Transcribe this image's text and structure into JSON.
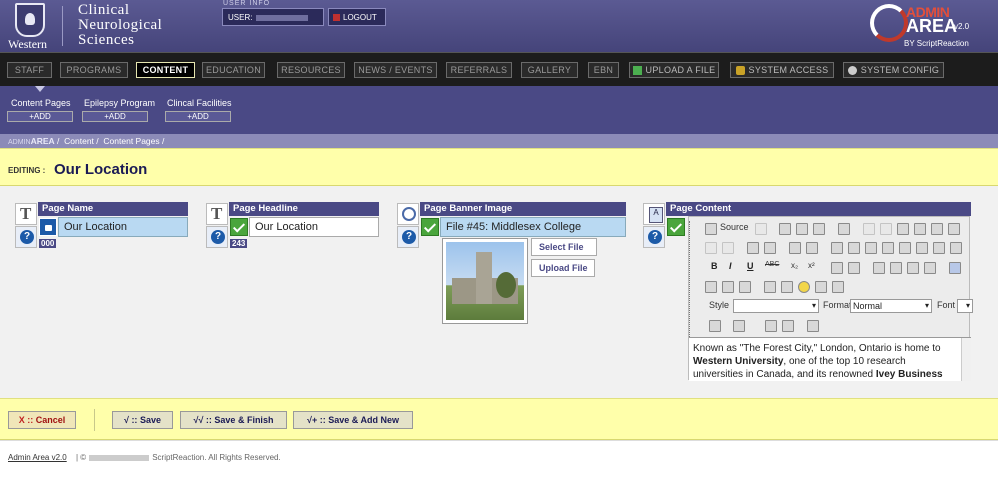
{
  "header": {
    "school": "Western",
    "department": "Clinical Neurological Sciences",
    "user_info_label": "USER INFO",
    "user_label": "USER:",
    "logout": "LOGOUT",
    "brand_top": "ADMIN",
    "brand_bottom": "AREA",
    "brand_version": "v2.0",
    "brand_by": "BY ScriptReaction"
  },
  "nav": [
    {
      "label": "STAFF"
    },
    {
      "label": "PROGRAMS"
    },
    {
      "label": "CONTENT",
      "active": true
    },
    {
      "label": "EDUCATION"
    },
    {
      "label": "RESOURCES"
    },
    {
      "label": "NEWS / EVENTS"
    },
    {
      "label": "REFERRALS"
    },
    {
      "label": "GALLERY"
    },
    {
      "label": "EBN"
    },
    {
      "label": "UPLOAD A FILE"
    },
    {
      "label": "SYSTEM ACCESS"
    },
    {
      "label": "SYSTEM CONFIG"
    }
  ],
  "subnav": [
    {
      "label": "Content Pages",
      "add": "+ADD"
    },
    {
      "label": "Epilepsy Program",
      "add": "+ADD"
    },
    {
      "label": "Clincal Facilities",
      "add": "+ADD"
    }
  ],
  "breadcrumb": {
    "admin1": "ADMIN",
    "admin2": "AREA",
    "sep": "/",
    "items": [
      "Content",
      "Content Pages"
    ]
  },
  "editing": {
    "label": "EDITING :",
    "title": "Our Location"
  },
  "fields": {
    "page_name": {
      "label": "Page Name",
      "value": "Our Location",
      "count": "000"
    },
    "page_headline": {
      "label": "Page Headline",
      "value": "Our Location",
      "count": "243"
    },
    "page_banner": {
      "label": "Page Banner Image",
      "value": "File #45: Middlesex College",
      "select": "Select File",
      "upload": "Upload File"
    },
    "page_content": {
      "label": "Page Content"
    }
  },
  "editor": {
    "source": "Source",
    "style_label": "Style",
    "format_label": "Format",
    "format_value": "Normal",
    "font_label": "Font",
    "content_plain1": "Known as \"The Forest City,\" London, Ontario is home to ",
    "content_bold1": "Western University",
    "content_plain2": ", one of the top 10 research universities in Canada, and its renowned ",
    "content_bold2": "Ivey Business"
  },
  "actions": {
    "cancel": "Cancel",
    "save": "Save",
    "save_finish": "Save & Finish",
    "save_new": "Save & Add New",
    "cancel_prefix": "X ::",
    "save_prefix": "√ ::",
    "save_finish_prefix": "√√ ::",
    "save_new_prefix": "√+ ::"
  },
  "footer": {
    "admin_link": "Admin Area v2.0",
    "copyright_prefix": "| ©",
    "copyright_suffix": "ScriptReaction. All Rights Reserved."
  },
  "colors": {
    "accent": "#4a4985",
    "highlight": "#ffffaa",
    "nav_bg": "#1c1c1c",
    "active": "#e6e6b0"
  }
}
